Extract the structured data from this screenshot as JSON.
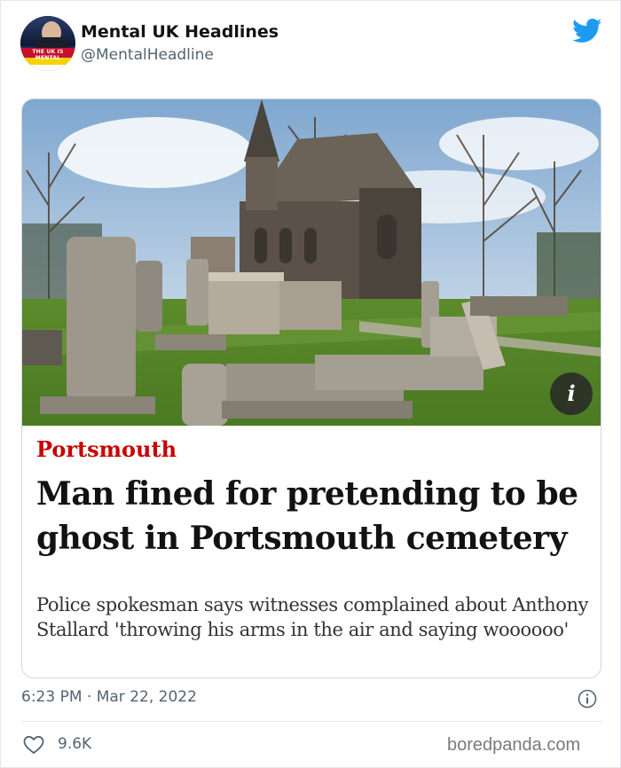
{
  "account": {
    "display_name": "Mental UK Headlines",
    "handle": "@MentalHeadline",
    "avatar_text": "THE UK IS MENTAL"
  },
  "card": {
    "section": "Portsmouth",
    "headline": "Man fined for pretending to be ghost in Portsmouth cemetery",
    "standfirst": "Police spokesman says witnesses complained about Anthony Stallard 'throwing his arms in the air and saying woooooo'",
    "info_glyph": "i"
  },
  "meta": {
    "timestamp": "6:23 PM · Mar 22, 2022",
    "likes": "9.6K"
  },
  "watermark": "boredpanda.com",
  "colors": {
    "twitter_blue": "#1d9bf0",
    "section_red": "#c70000",
    "muted": "#536471"
  },
  "icons": [
    "twitter-logo-icon",
    "info-icon",
    "heart-icon"
  ]
}
